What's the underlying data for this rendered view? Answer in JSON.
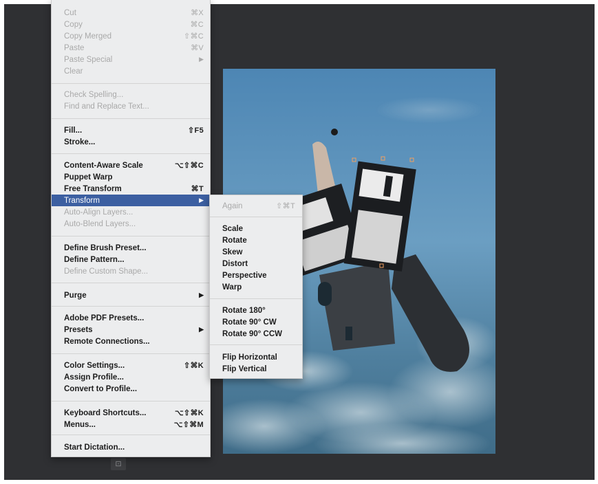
{
  "edit_menu": {
    "items": [
      {
        "label": "Cut",
        "shortcut": "⌘X",
        "state": "disabled"
      },
      {
        "label": "Copy",
        "shortcut": "⌘C",
        "state": "disabled"
      },
      {
        "label": "Copy Merged",
        "shortcut": "⇧⌘C",
        "state": "disabled"
      },
      {
        "label": "Paste",
        "shortcut": "⌘V",
        "state": "disabled"
      },
      {
        "label": "Paste Special",
        "shortcut": "",
        "submenu": true,
        "state": "disabled"
      },
      {
        "label": "Clear",
        "shortcut": "",
        "state": "disabled"
      },
      {
        "label": "Check Spelling...",
        "shortcut": "",
        "state": "disabled"
      },
      {
        "label": "Find and Replace Text...",
        "shortcut": "",
        "state": "disabled"
      },
      {
        "label": "Fill...",
        "shortcut": "⇧F5",
        "state": "enabled"
      },
      {
        "label": "Stroke...",
        "shortcut": "",
        "state": "enabled"
      },
      {
        "label": "Content-Aware Scale",
        "shortcut": "⌥⇧⌘C",
        "state": "enabled"
      },
      {
        "label": "Puppet Warp",
        "shortcut": "",
        "state": "enabled"
      },
      {
        "label": "Free Transform",
        "shortcut": "⌘T",
        "state": "enabled"
      },
      {
        "label": "Transform",
        "shortcut": "",
        "submenu": true,
        "state": "highlighted"
      },
      {
        "label": "Auto-Align Layers...",
        "shortcut": "",
        "state": "disabled"
      },
      {
        "label": "Auto-Blend Layers...",
        "shortcut": "",
        "state": "disabled"
      },
      {
        "label": "Define Brush Preset...",
        "shortcut": "",
        "state": "enabled"
      },
      {
        "label": "Define Pattern...",
        "shortcut": "",
        "state": "enabled"
      },
      {
        "label": "Define Custom Shape...",
        "shortcut": "",
        "state": "disabled"
      },
      {
        "label": "Purge",
        "shortcut": "",
        "submenu": true,
        "state": "enabled"
      },
      {
        "label": "Adobe PDF Presets...",
        "shortcut": "",
        "state": "enabled"
      },
      {
        "label": "Presets",
        "shortcut": "",
        "submenu": true,
        "state": "enabled"
      },
      {
        "label": "Remote Connections...",
        "shortcut": "",
        "state": "enabled"
      },
      {
        "label": "Color Settings...",
        "shortcut": "⇧⌘K",
        "state": "enabled"
      },
      {
        "label": "Assign Profile...",
        "shortcut": "",
        "state": "enabled"
      },
      {
        "label": "Convert to Profile...",
        "shortcut": "",
        "state": "enabled"
      },
      {
        "label": "Keyboard Shortcuts...",
        "shortcut": "⌥⇧⌘K",
        "state": "enabled"
      },
      {
        "label": "Menus...",
        "shortcut": "⌥⇧⌘M",
        "state": "enabled"
      },
      {
        "label": "Start Dictation...",
        "shortcut": "",
        "state": "enabled"
      }
    ]
  },
  "transform_submenu": {
    "items": [
      {
        "label": "Again",
        "shortcut": "⇧⌘T",
        "state": "disabled"
      },
      {
        "label": "Scale",
        "shortcut": "",
        "state": "enabled"
      },
      {
        "label": "Rotate",
        "shortcut": "",
        "state": "enabled"
      },
      {
        "label": "Skew",
        "shortcut": "",
        "state": "enabled"
      },
      {
        "label": "Distort",
        "shortcut": "",
        "state": "enabled"
      },
      {
        "label": "Perspective",
        "shortcut": "",
        "state": "enabled"
      },
      {
        "label": "Warp",
        "shortcut": "",
        "state": "enabled"
      },
      {
        "label": "Rotate 180°",
        "shortcut": "",
        "state": "enabled"
      },
      {
        "label": "Rotate 90° CW",
        "shortcut": "",
        "state": "enabled"
      },
      {
        "label": "Rotate 90° CCW",
        "shortcut": "",
        "state": "enabled"
      },
      {
        "label": "Flip Horizontal",
        "shortcut": "",
        "state": "enabled"
      },
      {
        "label": "Flip Vertical",
        "shortcut": "",
        "state": "enabled"
      }
    ]
  },
  "icons": {
    "submenu_arrow": "▶"
  },
  "colors": {
    "workspace_bg": "#2f3033",
    "menu_bg": "#ecedee",
    "highlight": "#3c5fa1",
    "disabled_text": "#a9a9a9"
  }
}
